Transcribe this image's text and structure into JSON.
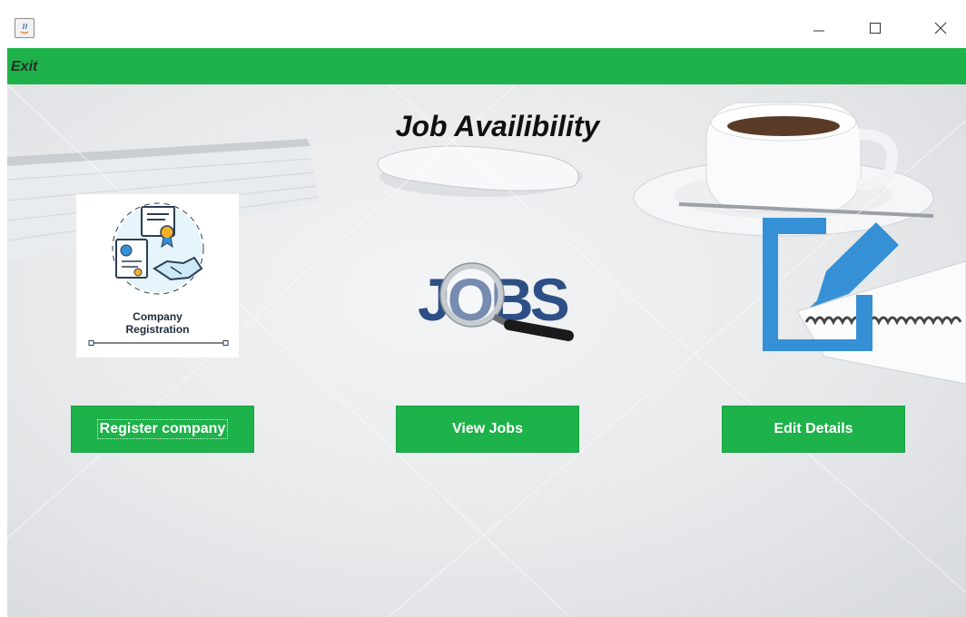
{
  "window": {
    "controls": [
      "minimize-icon",
      "maximize-icon",
      "close-icon"
    ]
  },
  "menu": {
    "exit_label": "Exit"
  },
  "main": {
    "title": "Job Availibility",
    "company_logo_caption_line1": "Company",
    "company_logo_caption_line2": "Registration",
    "jobs_logo_text": "JOBS",
    "buttons": {
      "register": "Register company",
      "view": "View Jobs",
      "edit": "Edit Details"
    }
  },
  "colors": {
    "accent_green": "#1db24a",
    "edit_icon_blue": "#3590d6"
  }
}
